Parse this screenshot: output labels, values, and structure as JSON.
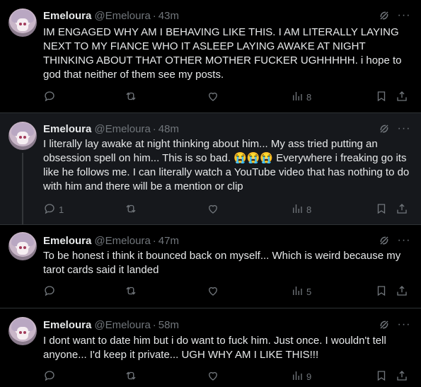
{
  "posts": [
    {
      "name": "Emeloura",
      "handle": "@Emeloura",
      "dot": "·",
      "time": "43m",
      "text": "IM ENGAGED WHY AM I BEHAVING LIKE THIS. I AM LITERALLY LAYING NEXT TO MY FIANCE WHO IT ASLEEP LAYING AWAKE AT NIGHT THINKING ABOUT THAT OTHER MOTHER FUCKER UGHHHHH. i hope to god that neither of them see my posts.",
      "replies": "",
      "reposts": "",
      "likes": "",
      "views": "8"
    },
    {
      "name": "Emeloura",
      "handle": "@Emeloura",
      "dot": "·",
      "time": "48m",
      "text": "I literally lay awake at night thinking about him... My ass tried putting an obsession spell on him... This is so bad. 😭😭😭 Everywhere i freaking go its like he follows me. I can literally watch a YouTube video that has nothing to do with him and there will be a mention or clip",
      "replies": "1",
      "reposts": "",
      "likes": "",
      "views": "8"
    },
    {
      "name": "Emeloura",
      "handle": "@Emeloura",
      "dot": "·",
      "time": "47m",
      "text": "To be honest i think it bounced back on myself... Which is weird because my tarot cards said it landed",
      "replies": "",
      "reposts": "",
      "likes": "",
      "views": "5"
    },
    {
      "name": "Emeloura",
      "handle": "@Emeloura",
      "dot": "·",
      "time": "58m",
      "text": "I dont want to date him but i do want to fuck him. Just once. I wouldn't tell anyone... I'd keep it private... UGH WHY AM I LIKE THIS!!!",
      "replies": "",
      "reposts": "",
      "likes": "",
      "views": "9"
    }
  ],
  "icons": {
    "grok": "grok-icon",
    "more": "more-icon",
    "reply": "reply-icon",
    "repost": "repost-icon",
    "like": "heart-icon",
    "views": "views-icon",
    "bookmark": "bookmark-icon",
    "share": "share-icon"
  },
  "more_glyph": "···",
  "colors": {
    "background": "#000000",
    "highlight": "#16181c",
    "muted": "#71767b",
    "text": "#e7e9ea",
    "divider": "#2f3336"
  }
}
